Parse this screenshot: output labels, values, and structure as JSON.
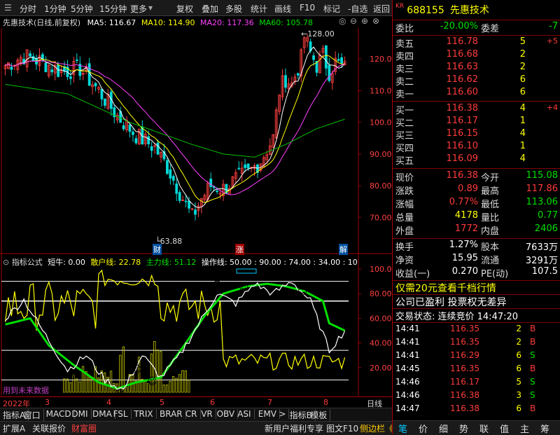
{
  "toolbar": {
    "items": [
      "分时",
      "1分钟",
      "5分钟",
      "15分钟",
      "更多",
      "复权",
      "叠加",
      "多股",
      "统计",
      "画线",
      "F10",
      "标记",
      "-自选",
      "返回"
    ]
  },
  "kline": {
    "title": "先惠技术(日线,前复权)",
    "ma5": "MA5: 116.67",
    "ma10": "MA10: 114.90",
    "ma20": "MA20: 117.36",
    "ma60": "MA60: 105.78",
    "high_label": "128.00",
    "low_label": "63.88",
    "y_ticks": [
      "120.0",
      "110.0",
      "100.0",
      "90.00",
      "80.00",
      "70.00"
    ],
    "markers": [
      "财",
      "涨",
      "解"
    ],
    "colors": {
      "ma5": "#ffffff",
      "ma10": "#ffff00",
      "ma20": "#ff40ff",
      "ma60": "#00c000",
      "up": "#ff4040",
      "down": "#00d8d8"
    }
  },
  "indicator": {
    "header_name": "指标公式",
    "short": "短牛: 0.00",
    "retail": "散户线: 22.78",
    "main": "主力线: 51.12",
    "op": "操作线: 50.00 : 90.00 : 74.00 : 34.00 : 10",
    "y_ticks": [
      "100.0",
      "80.00",
      "60.00",
      "40.00",
      "20.00"
    ],
    "footer_hint": "用到未来数据"
  },
  "xaxis": {
    "year": "2022年",
    "months": [
      "3",
      "4",
      "5",
      "6",
      "7",
      "8"
    ],
    "period": "日线"
  },
  "tabs": [
    "指标A",
    "窗口",
    "MACD",
    "DMI",
    "DMA",
    "FSL",
    "TRIX",
    "BRAR",
    "CR",
    "VR",
    "OBV",
    "ASI",
    "EMV",
    ">",
    "指标B",
    "模板"
  ],
  "bottom_bar": {
    "left": [
      "扩展A",
      "关联报价",
      "财富圈"
    ],
    "right": [
      "新用户福利专享",
      "图文F10",
      "侧边栏《"
    ]
  },
  "quote": {
    "code": "688155",
    "name": "先惠技术",
    "wb_label": "委比",
    "wb_value": "-20.00%",
    "wc_label": "委差",
    "wc_value": "-7",
    "asks": [
      {
        "label": "卖五",
        "price": "116.78",
        "vol": "5",
        "chg": "+5"
      },
      {
        "label": "卖四",
        "price": "116.68",
        "vol": "2",
        "chg": ""
      },
      {
        "label": "卖三",
        "price": "116.63",
        "vol": "2",
        "chg": ""
      },
      {
        "label": "卖二",
        "price": "116.62",
        "vol": "6",
        "chg": ""
      },
      {
        "label": "卖一",
        "price": "116.60",
        "vol": "6",
        "chg": ""
      }
    ],
    "bids": [
      {
        "label": "买一",
        "price": "116.38",
        "vol": "4",
        "chg": "+4"
      },
      {
        "label": "买二",
        "price": "116.17",
        "vol": "1",
        "chg": ""
      },
      {
        "label": "买三",
        "price": "116.15",
        "vol": "4",
        "chg": ""
      },
      {
        "label": "买四",
        "price": "116.10",
        "vol": "1",
        "chg": ""
      },
      {
        "label": "买五",
        "price": "116.09",
        "vol": "4",
        "chg": ""
      }
    ],
    "stats": [
      {
        "l1": "现价",
        "v1": "116.38",
        "c1": "red",
        "l2": "今开",
        "v2": "115.08",
        "c2": "grn"
      },
      {
        "l1": "涨跌",
        "v1": "0.89",
        "c1": "red",
        "l2": "最高",
        "v2": "117.86",
        "c2": "red"
      },
      {
        "l1": "涨幅",
        "v1": "0.77%",
        "c1": "red",
        "l2": "最低",
        "v2": "113.06",
        "c2": "grn"
      },
      {
        "l1": "总量",
        "v1": "4178",
        "c1": "yel",
        "l2": "量比",
        "v2": "0.77",
        "c2": "grn"
      },
      {
        "l1": "外盘",
        "v1": "1772",
        "c1": "red",
        "l2": "内盘",
        "v2": "2406",
        "c2": "grn"
      }
    ],
    "stats2": [
      {
        "l1": "换手",
        "v1": "1.27%",
        "l2": "股本",
        "v2": "7633万"
      },
      {
        "l1": "净资",
        "v1": "15.95",
        "l2": "流通",
        "v2": "3291万"
      },
      {
        "l1": "收益(一)",
        "v1": "0.270",
        "l2": "PE(动)",
        "v2": "107.5"
      }
    ],
    "promo1": "仅需20元查看千档行情",
    "promo2": "公司已盈利 投票权无差异",
    "status": "交易状态: 连续竞价 14:47:20",
    "ticks": [
      {
        "time": "14:41",
        "price": "116.35",
        "vol": "2",
        "bs": "B"
      },
      {
        "time": "14:41",
        "price": "116.35",
        "vol": "2",
        "bs": "B"
      },
      {
        "time": "14:41",
        "price": "116.29",
        "vol": "6",
        "bs": "S"
      },
      {
        "time": "14:45",
        "price": "116.35",
        "vol": "6",
        "bs": "B"
      },
      {
        "time": "14:46",
        "price": "116.17",
        "vol": "5",
        "bs": "S"
      },
      {
        "time": "14:46",
        "price": "116.38",
        "vol": "3",
        "bs": "S"
      },
      {
        "time": "14:47",
        "price": "116.38",
        "vol": "6",
        "bs": "B"
      }
    ],
    "nav": [
      "笔",
      "价",
      "细",
      "势",
      "联",
      "值",
      "主",
      "筹"
    ]
  }
}
